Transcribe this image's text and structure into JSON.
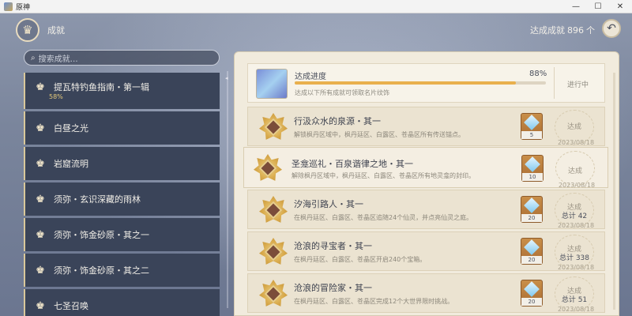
{
  "window": {
    "title": "原神",
    "minimize": "—",
    "maximize": "☐",
    "close": "✕"
  },
  "header": {
    "title": "成就",
    "progress_label": "达成成就",
    "progress_value": "896",
    "progress_unit": "个"
  },
  "search": {
    "placeholder": "搜索成就…"
  },
  "sidebar": {
    "items": [
      {
        "label": "提瓦特钓鱼指南・第一辑",
        "percent": "58%"
      },
      {
        "label": "白昼之光"
      },
      {
        "label": "岩窟流明"
      },
      {
        "label": "须弥・玄识深藏的雨林"
      },
      {
        "label": "须弥・饰金砂原・其之一"
      },
      {
        "label": "须弥・饰金砂原・其之二"
      },
      {
        "label": "七圣召唤"
      }
    ]
  },
  "summary": {
    "title": "达成进度",
    "percent_text": "88%",
    "percent": 88,
    "description": "达成以下所有成就可领取名片纹饰",
    "status": "进行中"
  },
  "achievements": [
    {
      "title": "行汲众水的泉源・其一",
      "desc": "解锁枫丹区域中，枫丹廷区、白露区、苍晶区所有传送锚点。",
      "reward": "5",
      "done": "达成",
      "total": "",
      "date": "2023/08/18"
    },
    {
      "title": "圣龛巡礼・百泉谐律之地・其一",
      "desc": "解除枫丹区域中，枫丹廷区、白露区、苍晶区所有地灵龛的封印。",
      "reward": "10",
      "done": "达成",
      "total": "",
      "date": "2023/08/18"
    },
    {
      "title": "汐海引路人・其一",
      "desc": "在枫丹廷区、白露区、苍晶区追随24个仙灵，并点亮仙灵之庭。",
      "reward": "20",
      "done": "达成",
      "total": "总计 42",
      "date": "2023/08/18"
    },
    {
      "title": "沧浪的寻宝者・其一",
      "desc": "在枫丹廷区、白露区、苍晶区开启240个宝箱。",
      "reward": "20",
      "done": "达成",
      "total": "总计 338",
      "date": "2023/08/18"
    },
    {
      "title": "沧浪的冒险家・其一",
      "desc": "在枫丹廷区、白露区、苍晶区完成12个大世界限时挑战。",
      "reward": "20",
      "done": "达成",
      "total": "总计 51",
      "date": "2023/08/18"
    }
  ]
}
